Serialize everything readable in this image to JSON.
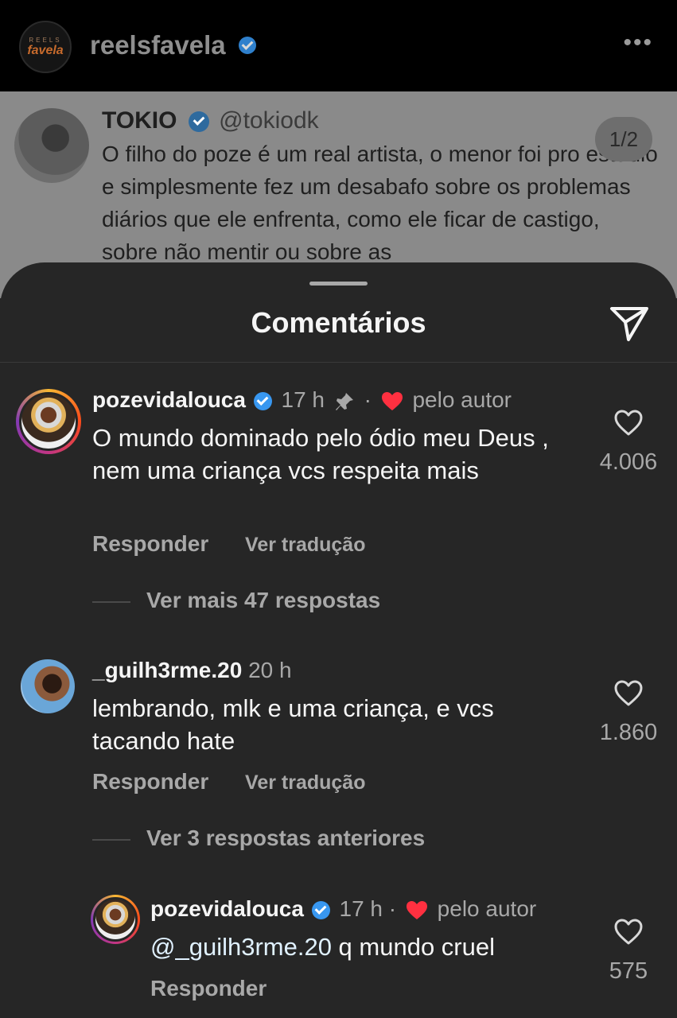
{
  "header": {
    "account_name": "reelsfavela",
    "avatar_line1": "REELS",
    "avatar_line2": "favela",
    "more_icon": "more-dots-icon"
  },
  "tweet": {
    "author_name": "TOKIO",
    "author_handle": "@tokiodk",
    "text": "O filho do poze é um real artista, o menor foi pro estúdio e simplesmente fez um desabafo sobre os problemas diários que ele enfrenta, como ele ficar de castigo, sobre não mentir ou sobre as",
    "counter": "1/2"
  },
  "sheet": {
    "title": "Comentários",
    "send_icon": "send-icon"
  },
  "comments": [
    {
      "username": "pozevidalouca",
      "time": "17 h",
      "pinned": true,
      "separator": "·",
      "liked_by_author": "pelo autor",
      "text": "O mundo dominado pelo ódio meu Deus , nem uma criança vcs respeita mais",
      "reply_label": "Responder",
      "translate_label": "Ver tradução",
      "likes": "4.006",
      "more_replies": "Ver mais 47 respostas"
    },
    {
      "username": "_guilh3rme.20",
      "time": "20 h",
      "text": "lembrando, mlk e uma criança, e vcs tacando hate",
      "reply_label": "Responder",
      "translate_label": "Ver tradução",
      "likes": "1.860",
      "more_replies": "Ver 3 respostas anteriores"
    },
    {
      "username": "pozevidalouca",
      "time": "17 h",
      "separator": "·",
      "liked_by_author": "pelo autor",
      "mention": "@_guilh3rme.20",
      "text": " q mundo cruel",
      "reply_label": "Responder",
      "likes": "575"
    }
  ],
  "colors": {
    "background": "#262626",
    "verified": "#3897f0",
    "heart_red": "#ff3040",
    "muted_text": "#a8a8a8"
  }
}
